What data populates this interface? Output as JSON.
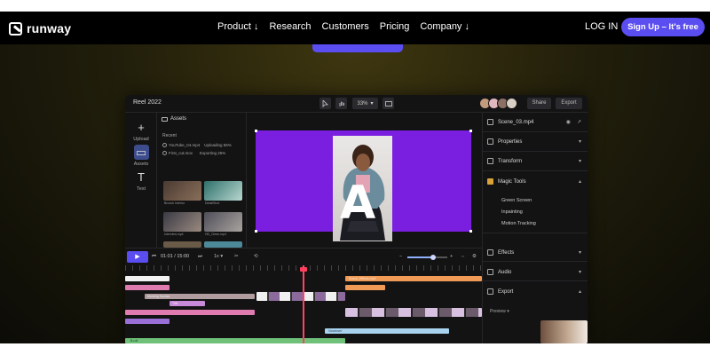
{
  "nav": {
    "brand": "runway",
    "links": [
      "Product ↓",
      "Research",
      "Customers",
      "Pricing",
      "Company ↓"
    ],
    "login": "LOG IN",
    "signup": "Sign Up – It's free"
  },
  "editor": {
    "project_title": "Reel 2022",
    "zoom": "33%",
    "share": "Share",
    "export": "Export",
    "rail": [
      {
        "label": "Upload",
        "icon": "plus-icon"
      },
      {
        "label": "Assets",
        "icon": "folder-icon"
      },
      {
        "label": "Text",
        "icon": "text-icon"
      }
    ],
    "assets": {
      "title": "Assets",
      "recent_label": "Recent",
      "uploads": [
        {
          "name": "YouTube_04.mp4",
          "status": "Uploading 56%"
        },
        {
          "name": "First_cut.mov",
          "status": "Exporting 26%"
        }
      ],
      "thumbs": [
        "Brunch Interior",
        "DetailShot",
        "Interview.mp4",
        "HD_Clean.mp4"
      ]
    },
    "canvas": {
      "caption": "RUNWAY"
    },
    "right_panel": {
      "file_name": "Scene_03.mp4",
      "properties": "Properties",
      "transform": "Transform",
      "magic_tools": "Magic Tools",
      "tools": [
        "Green Screen",
        "Inpainting",
        "Motion Tracking"
      ],
      "effects": "Effects",
      "audio": "Audio",
      "export": "Export",
      "preview": "Preview"
    },
    "timeline": {
      "time": "01:01 / 15:00",
      "speed": "1x",
      "clip_labels": [
        "Sound_Effects.mp3",
        "Morning Sunrise",
        "Voiceover",
        "Title",
        "B-roll"
      ],
      "playhead_fraction": 0.5
    }
  }
}
